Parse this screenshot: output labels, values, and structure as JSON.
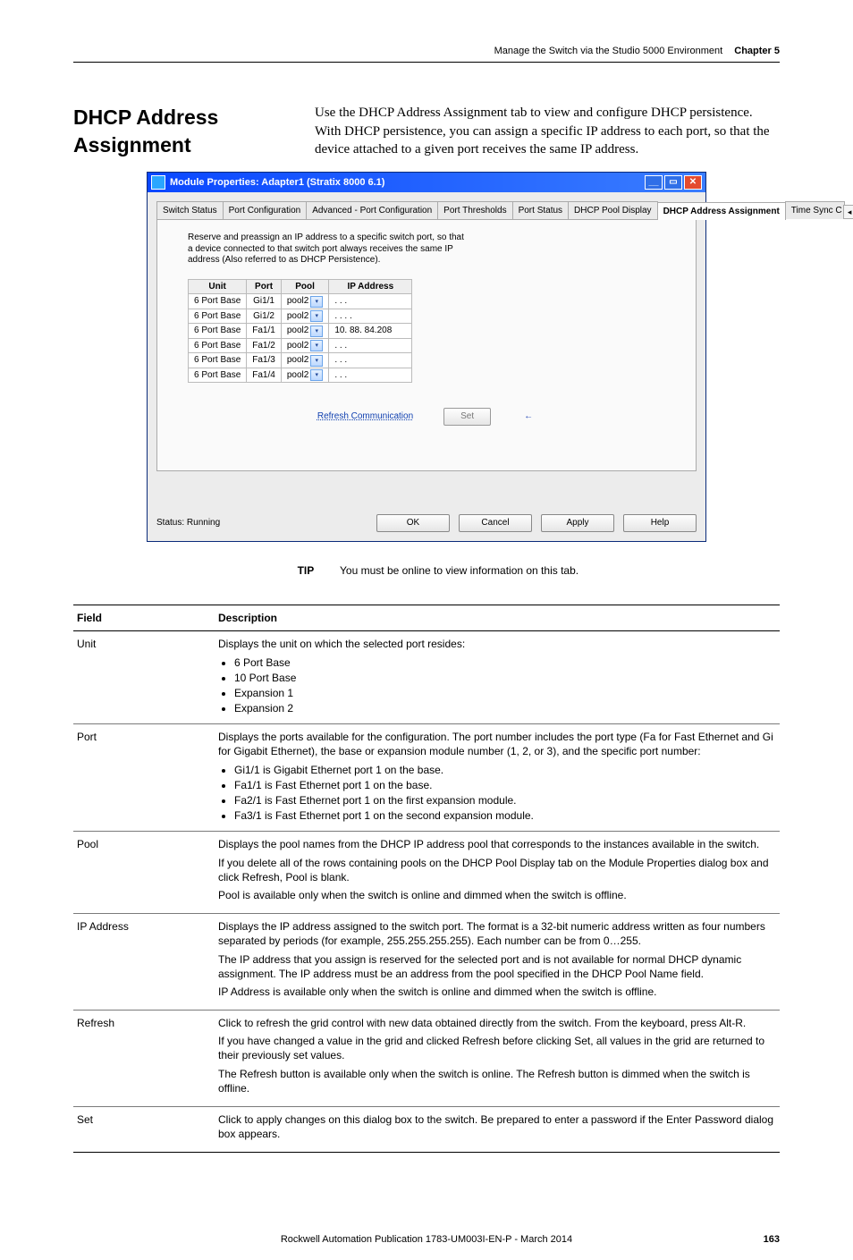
{
  "header": {
    "breadcrumb": "Manage the Switch via the Studio 5000 Environment",
    "chapter": "Chapter 5"
  },
  "section": {
    "title": "DHCP Address Assignment",
    "body": "Use the DHCP Address Assignment tab to view and configure DHCP persistence. With DHCP persistence, you can assign a specific IP address to each port, so that the device attached to a given port receives the same IP address."
  },
  "dialog": {
    "title": "Module Properties: Adapter1 (Stratix 8000 6.1)",
    "tabs": {
      "t0": "Switch Status",
      "t1": "Port Configuration",
      "t2": "Advanced - Port Configuration",
      "t3": "Port Thresholds",
      "t4": "Port Status",
      "t5": "DHCP Pool Display",
      "t6": "DHCP Address Assignment",
      "t7": "Time Sync C"
    },
    "blurb": "Reserve and preassign an IP address to a specific switch port, so that a device connected to that switch port always receives the same IP address (Also referred to as DHCP Persistence).",
    "grid_headers": {
      "unit": "Unit",
      "port": "Port",
      "pool": "Pool",
      "ip": "IP Address"
    },
    "grid_rows": [
      {
        "unit": "6 Port Base",
        "port": "Gi1/1",
        "pool": "pool2",
        "ip": ". . ."
      },
      {
        "unit": "6 Port Base",
        "port": "Gi1/2",
        "pool": "pool2",
        "ip": ". . . ."
      },
      {
        "unit": "6 Port Base",
        "port": "Fa1/1",
        "pool": "pool2",
        "ip": "10. 88. 84.208"
      },
      {
        "unit": "6 Port Base",
        "port": "Fa1/2",
        "pool": "pool2",
        "ip": ". . ."
      },
      {
        "unit": "6 Port Base",
        "port": "Fa1/3",
        "pool": "pool2",
        "ip": ". . ."
      },
      {
        "unit": "6 Port Base",
        "port": "Fa1/4",
        "pool": "pool2",
        "ip": ". . ."
      }
    ],
    "actions": {
      "refresh": "Refresh Communication",
      "set": "Set"
    },
    "status": "Status: Running",
    "buttons": {
      "ok": "OK",
      "cancel": "Cancel",
      "apply": "Apply",
      "help": "Help"
    }
  },
  "tip": {
    "label": "TIP",
    "text": "You must be online to view information on this tab."
  },
  "field_table": {
    "headers": {
      "field": "Field",
      "desc": "Description"
    },
    "rows": {
      "unit": {
        "field": "Unit",
        "lead": "Displays the unit on which the selected port resides:",
        "b0": "6 Port Base",
        "b1": "10 Port Base",
        "b2": "Expansion 1",
        "b3": "Expansion 2"
      },
      "port": {
        "field": "Port",
        "lead": "Displays the ports available for the configuration. The port number includes the port type (Fa for Fast Ethernet and Gi for Gigabit Ethernet), the base or expansion module number (1, 2, or 3), and the specific port number:",
        "b0": "Gi1/1 is Gigabit Ethernet port 1 on the base.",
        "b1": "Fa1/1 is Fast Ethernet port 1 on the base.",
        "b2": "Fa2/1 is Fast Ethernet port 1 on the first expansion module.",
        "b3": "Fa3/1 is Fast Ethernet port 1 on the second expansion module."
      },
      "pool": {
        "field": "Pool",
        "p0": "Displays the pool names from the DHCP IP address pool that corresponds to the instances available in the switch.",
        "p1": "If you delete all of the rows containing pools on the DHCP Pool Display tab on the Module Properties dialog box and click Refresh, Pool is blank.",
        "p2": "Pool is available only when the switch is online and dimmed when the switch is offline."
      },
      "ip": {
        "field": "IP Address",
        "p0": "Displays the IP address assigned to the switch port. The format is a 32-bit numeric address written as four numbers separated by periods (for example, 255.255.255.255). Each number can be from 0…255.",
        "p1": "The IP address that you assign is reserved for the selected port and is not available for normal DHCP dynamic assignment. The IP address must be an address from the pool specified in the DHCP Pool Name field.",
        "p2": "IP Address is available only when the switch is online and dimmed when the switch is offline."
      },
      "refresh": {
        "field": "Refresh",
        "p0": "Click to refresh the grid control with new data obtained directly from the switch. From the keyboard, press Alt-R.",
        "p1": "If you have changed a value in the grid and clicked Refresh before clicking Set, all values in the grid are returned to their previously set values.",
        "p2": "The Refresh button is available only when the switch is online. The Refresh button is dimmed when the switch is offline."
      },
      "set": {
        "field": "Set",
        "p0": "Click to apply changes on this dialog box to the switch. Be prepared to enter a password if the Enter Password dialog box appears."
      }
    }
  },
  "footer": {
    "pub": "Rockwell Automation Publication 1783-UM003I-EN-P - March 2014",
    "page": "163"
  }
}
